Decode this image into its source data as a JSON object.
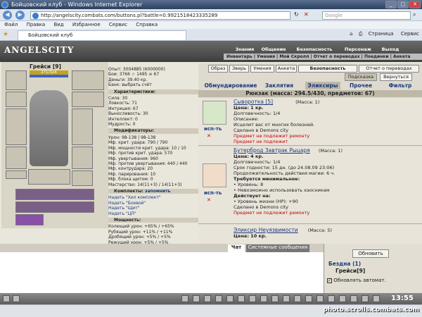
{
  "browser": {
    "title": "Бойцовский клуб - Windows Internet Explorer",
    "url": "http://angelscity.combats.com/buttons.pl?battle=0.9921518423335289",
    "search_placeholder": "Google",
    "menu": [
      "Файл",
      "Правка",
      "Вид",
      "Избранное",
      "Сервис",
      "Справка"
    ],
    "tab_title": "Бойцовский клуб",
    "toolbar_right": [
      "Страница",
      "Сервис"
    ]
  },
  "game": {
    "logo": "ANGELSCITY",
    "nav": [
      "Знания",
      "Общение",
      "Безопасность",
      "Персонаж",
      "Выход"
    ],
    "subnav": "Инвентарь | Умения | Мой Скролл | Отчет о переводах | Поединки | Анкета",
    "character": {
      "name": "Грейси",
      "level": "[9]",
      "hp_text": "271/324",
      "hp_fraction": 0.84
    },
    "stats_top": [
      "Опыт: 3004885 (6000000)",
      "Бои: 3766 ☆ 1495 ☠ 67",
      "Деньги: 39.40 кр.",
      "Банк: выбрать счёт"
    ],
    "characteristics_title": "Характеристики:",
    "characteristics": [
      "Сила: 30",
      "Ловкость: 71",
      "Интуиция: 67",
      "Выносливость: 30",
      "Интеллект: 0",
      "Мудрость: 0"
    ],
    "modifiers_title": "Модификаторы:",
    "modifiers": [
      "Урон: 98-138 | 98-138",
      "Мф. крит. удара: 790 / 790",
      "Мф. мощности крит. удара: 10 / 10",
      "Мф. против крит. удара: 570",
      "Мф. увертывания: 960",
      "Мф. против увертывания: 440 / 440",
      "Мф. контрудара: 20",
      "Мф. парирования: 10",
      "Мф. блока щитом: 0",
      "Мастерство: 14(11+3) / 14(11+3)"
    ],
    "sets_title": "Комплекты:",
    "sets_remember": "запомнить",
    "sets": [
      "Надеть \"Хил комплект\"",
      "Надеть \"Боевой\"",
      "Надеть \"Щит\"",
      "Надеть \"ЦП\""
    ],
    "power_title": "Мощность:",
    "power": [
      "Колющий урон: +65% / +65%",
      "Рубящий урон: +11% / +11%",
      "Дробящий урон: +5% / +5%",
      "Режущий урон: +5% / +5%"
    ],
    "top_buttons": [
      "Образ",
      "Зверь",
      "Умения",
      "Анкета",
      "Безопасность",
      "Отчет о переводах"
    ],
    "top_buttons2": [
      "Подсказка",
      "Вернуться"
    ],
    "tabs": [
      "Обмундирование",
      "Заклятия",
      "Эликсиры",
      "Прочее",
      "Фильтр"
    ],
    "bag": "Рюкзак (масса: 294.5/430, предметов: 67)",
    "items": [
      {
        "name": "Сыворотка [5]",
        "mass": "(Масса: 1)",
        "price": "Цена: 1 кр.",
        "durability": "Долговечность: 1/4",
        "desc_label": "Описание:",
        "desc": "Исцелит вас от многих болезней.",
        "made": "Сделано в Demons city",
        "note1": "Предмет не подлежит ремонту",
        "note2": "Предмет не подлежит",
        "action": "исп-ть"
      },
      {
        "name": "Бутерброд Завтрак Рыцаря",
        "mass": "(Масса: 1)",
        "price": "Цена: 4 кр.",
        "durability": "Долговечность: 1/4",
        "expiry": "Срок годности: 15 дн. (до 24.08.09 23:06)",
        "duration": "Продолжительность действия магии: 6 ч.",
        "req_title": "Требуется минимальное:",
        "req": "• Уровень: 8",
        "req2": "• Невозможно использовать хаосникам",
        "effect_title": "Действует на:",
        "effect": "• Уровень жизни (HP): +90",
        "made": "Сделано в Demons city",
        "note1": "Предмет не подлежит ремонту",
        "action": "исп-ть"
      },
      {
        "name": "Эликсир Неуязвимости",
        "mass": "(Масса: 5)",
        "price": "Цена: 10 кр."
      }
    ],
    "chat_tabs": [
      "Чат",
      "Системные сообщения"
    ],
    "side": {
      "refresh": "Обновить",
      "location": "Бездна (1)",
      "player": "Грейси[9]",
      "auto": "Обновлять автомат."
    },
    "clock": "13:55",
    "watermark": "photo.scrolls.combats.com"
  },
  "colors": {
    "link": "#1c3b7c",
    "title_bar": "#2c3f5e",
    "hp": "#c7a21d"
  }
}
